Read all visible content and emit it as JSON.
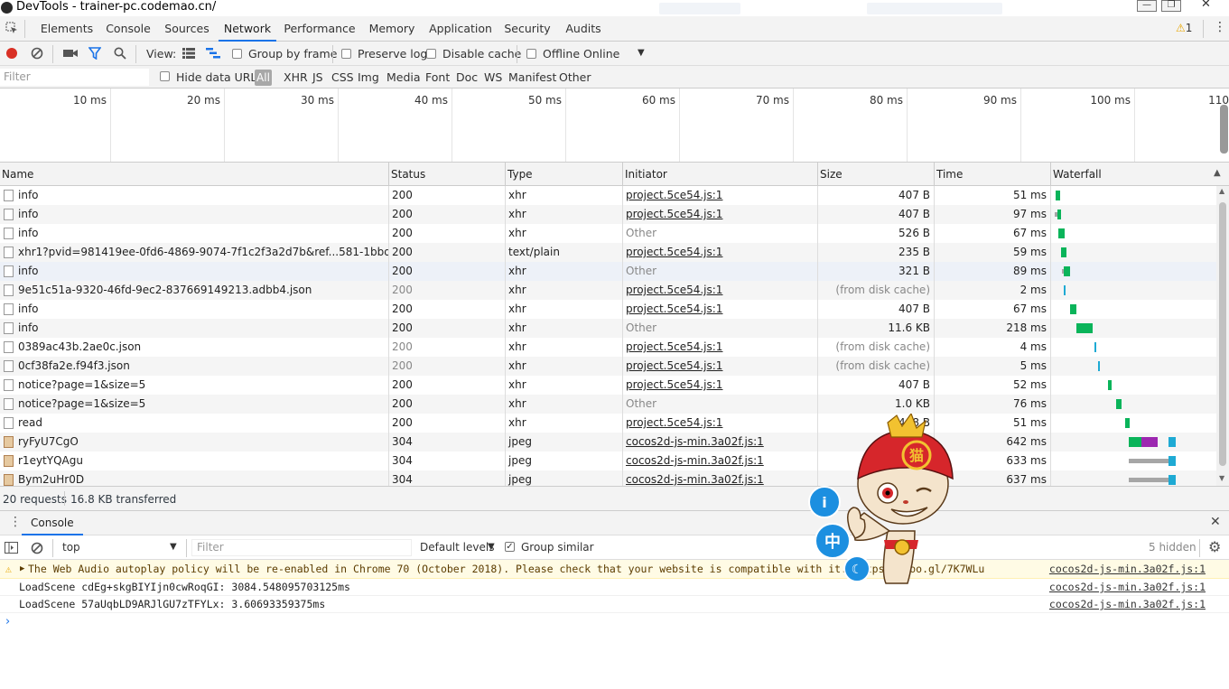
{
  "window": {
    "title": "DevTools - trainer-pc.codemao.cn/",
    "controls": [
      "minimize",
      "restore",
      "close"
    ]
  },
  "tabs": [
    "Elements",
    "Console",
    "Sources",
    "Network",
    "Performance",
    "Memory",
    "Application",
    "Security",
    "Audits"
  ],
  "active_tab": "Network",
  "warning_count": "1",
  "toolbar": {
    "view_label": "View:",
    "group_by_frame": "Group by frame",
    "preserve_log": "Preserve log",
    "disable_cache": "Disable cache",
    "offline": "Offline",
    "throttle": "Online"
  },
  "filterbar": {
    "placeholder": "Filter",
    "hide_data_urls": "Hide data URLs",
    "types": [
      "All",
      "XHR",
      "JS",
      "CSS",
      "Img",
      "Media",
      "Font",
      "Doc",
      "WS",
      "Manifest",
      "Other"
    ]
  },
  "overview": {
    "ticks": [
      "10 ms",
      "20 ms",
      "30 ms",
      "40 ms",
      "50 ms",
      "60 ms",
      "70 ms",
      "80 ms",
      "90 ms",
      "100 ms",
      "110"
    ]
  },
  "columns": [
    "Name",
    "Status",
    "Type",
    "Initiator",
    "Size",
    "Time",
    "Waterfall"
  ],
  "requests": [
    {
      "name": "info",
      "status": "200",
      "type": "xhr",
      "initiator": "project.5ce54.js:1",
      "size": "407 B",
      "time": "51 ms",
      "icon": "doc"
    },
    {
      "name": "info",
      "status": "200",
      "type": "xhr",
      "initiator": "project.5ce54.js:1",
      "size": "407 B",
      "time": "97 ms",
      "icon": "doc"
    },
    {
      "name": "info",
      "status": "200",
      "type": "xhr",
      "initiator": "Other",
      "size": "526 B",
      "time": "67 ms",
      "icon": "doc"
    },
    {
      "name": "xhr1?pvid=981419ee-0fd6-4869-9074-7f1c2f3a2d7b&ref...581-1bbd-4c56...",
      "status": "200",
      "type": "text/plain",
      "initiator": "project.5ce54.js:1",
      "size": "235 B",
      "time": "59 ms",
      "icon": "doc"
    },
    {
      "name": "info",
      "status": "200",
      "type": "xhr",
      "initiator": "Other",
      "size": "321 B",
      "time": "89 ms",
      "icon": "doc"
    },
    {
      "name": "9e51c51a-9320-46fd-9ec2-837669149213.adbb4.json",
      "status": "200",
      "type": "xhr",
      "initiator": "project.5ce54.js:1",
      "size": "(from disk cache)",
      "time": "2 ms",
      "icon": "doc"
    },
    {
      "name": "info",
      "status": "200",
      "type": "xhr",
      "initiator": "project.5ce54.js:1",
      "size": "407 B",
      "time": "67 ms",
      "icon": "doc"
    },
    {
      "name": "info",
      "status": "200",
      "type": "xhr",
      "initiator": "Other",
      "size": "11.6 KB",
      "time": "218 ms",
      "icon": "doc"
    },
    {
      "name": "0389ac43b.2ae0c.json",
      "status": "200",
      "type": "xhr",
      "initiator": "project.5ce54.js:1",
      "size": "(from disk cache)",
      "time": "4 ms",
      "icon": "doc"
    },
    {
      "name": "0cf38fa2e.f94f3.json",
      "status": "200",
      "type": "xhr",
      "initiator": "project.5ce54.js:1",
      "size": "(from disk cache)",
      "time": "5 ms",
      "icon": "doc"
    },
    {
      "name": "notice?page=1&size=5",
      "status": "200",
      "type": "xhr",
      "initiator": "project.5ce54.js:1",
      "size": "407 B",
      "time": "52 ms",
      "icon": "doc"
    },
    {
      "name": "notice?page=1&size=5",
      "status": "200",
      "type": "xhr",
      "initiator": "Other",
      "size": "1.0 KB",
      "time": "76 ms",
      "icon": "doc"
    },
    {
      "name": "read",
      "status": "200",
      "type": "xhr",
      "initiator": "project.5ce54.js:1",
      "size": "408 B",
      "time": "51 ms",
      "icon": "doc"
    },
    {
      "name": "ryFyU7CgO",
      "status": "304",
      "type": "jpeg",
      "initiator": "cocos2d-js-min.3a02f.js:1",
      "size": "",
      "time": "642 ms",
      "icon": "img"
    },
    {
      "name": "r1eytYQAgu",
      "status": "304",
      "type": "jpeg",
      "initiator": "cocos2d-js-min.3a02f.js:1",
      "size": "",
      "time": "633 ms",
      "icon": "img"
    },
    {
      "name": "Bym2uHr0D",
      "status": "304",
      "type": "jpeg",
      "initiator": "cocos2d-js-min.3a02f.js:1",
      "size": "",
      "time": "637 ms",
      "icon": "img"
    }
  ],
  "status": {
    "requests": "20 requests",
    "transferred": "16.8 KB transferred"
  },
  "drawer": {
    "tab": "Console",
    "context": "top",
    "filter_placeholder": "Filter",
    "levels": "Default levels",
    "group_similar": "Group similar",
    "hidden": "5 hidden"
  },
  "console_messages": [
    {
      "level": "warning",
      "text": "The Web Audio autoplay policy will be re-enabled in Chrome 70 (October 2018). Please check that your website is compatible with it. https://goo.gl/7K7WLu",
      "source": "cocos2d-js-min.3a02f.js:1"
    },
    {
      "level": "log",
      "text": "LoadScene cdEg+skgBIYIjn0cwRoqGI: 3084.548095703125ms",
      "source": "cocos2d-js-min.3a02f.js:1"
    },
    {
      "level": "log",
      "text": "LoadScene 57aUqbLD9ARJlGU7zTFYLx: 3.60693359375ms",
      "source": "cocos2d-js-min.3a02f.js:1"
    }
  ],
  "overlay": {
    "mascot_char": "猫",
    "bubble_chinese_char": "中",
    "bubble_info": "i",
    "bubble_moon": "☾"
  },
  "colors": {
    "accent": "#1a73e8",
    "record": "#d93025",
    "waterfall_green": "#0ab45a",
    "waterfall_purple": "#9c27b0",
    "waterfall_blue": "#1eaad4",
    "waterfall_grey": "#a6a6a6",
    "mascot_red": "#d6262b"
  }
}
